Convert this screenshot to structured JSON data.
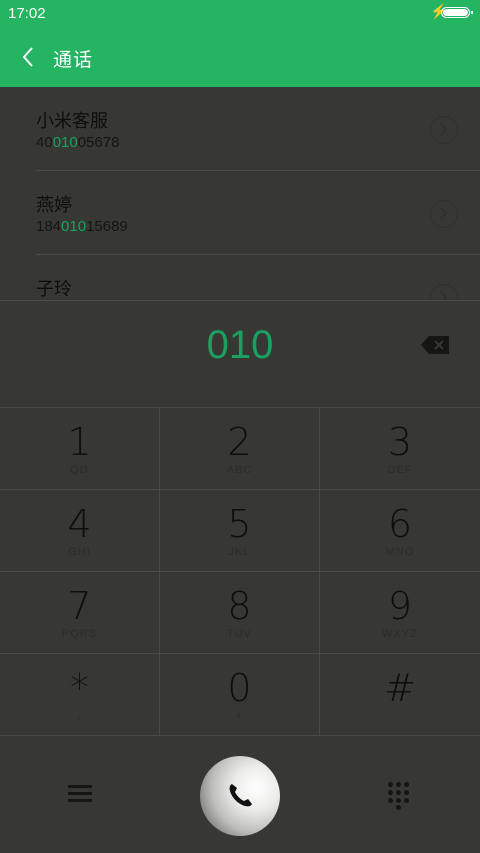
{
  "status_bar": {
    "time": "17:02",
    "charging_icon": "bolt-icon",
    "battery_level": 1.0
  },
  "app_bar": {
    "back_icon": "chevron-left-icon",
    "title": "通话"
  },
  "contacts": [
    {
      "name": "小米客服",
      "number_prefix": "40",
      "number_match": "010",
      "number_suffix": "05678"
    },
    {
      "name": "燕婷",
      "number_prefix": "184",
      "number_match": "010",
      "number_suffix": "15689"
    },
    {
      "name": "子玲",
      "number_prefix": "",
      "number_match": "",
      "number_suffix": ""
    }
  ],
  "dial_input": {
    "digits": "010",
    "backspace_icon": "backspace-icon"
  },
  "keypad": [
    {
      "digit": "1",
      "letters": "QD"
    },
    {
      "digit": "2",
      "letters": "ABC"
    },
    {
      "digit": "3",
      "letters": "DEF"
    },
    {
      "digit": "4",
      "letters": "GHI"
    },
    {
      "digit": "5",
      "letters": "JKL"
    },
    {
      "digit": "6",
      "letters": "MNO"
    },
    {
      "digit": "7",
      "letters": "PQRS"
    },
    {
      "digit": "8",
      "letters": "TUV"
    },
    {
      "digit": "9",
      "letters": "WXYZ"
    },
    {
      "digit": "*",
      "letters": ","
    },
    {
      "digit": "0",
      "letters": "+"
    },
    {
      "digit": "#",
      "letters": ""
    }
  ],
  "bottom_bar": {
    "menu_icon": "menu-icon",
    "call_icon": "phone-icon",
    "keypad_icon": "dialpad-icon"
  },
  "colors": {
    "accent": "#24b462",
    "highlight": "#1aa162",
    "background": "#373733"
  }
}
